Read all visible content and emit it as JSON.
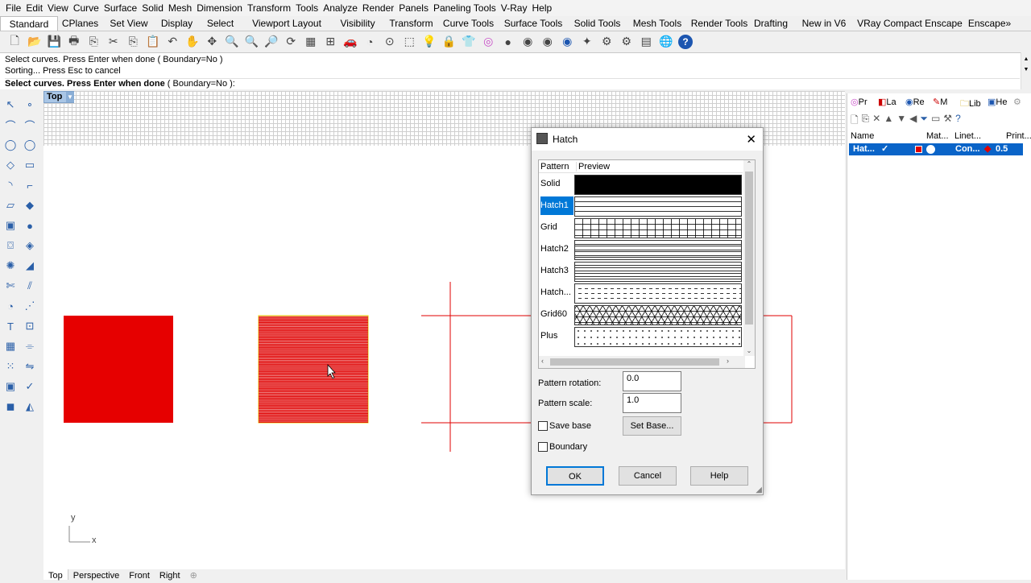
{
  "menu": [
    "File",
    "Edit",
    "View",
    "Curve",
    "Surface",
    "Solid",
    "Mesh",
    "Dimension",
    "Transform",
    "Tools",
    "Analyze",
    "Render",
    "Panels",
    "Paneling Tools",
    "V-Ray",
    "Help"
  ],
  "tabs": [
    "Standard",
    "CPlanes",
    "Set View",
    "Display",
    "Select",
    "Viewport Layout",
    "Visibility",
    "Transform",
    "Curve Tools",
    "Surface Tools",
    "Solid Tools",
    "Mesh Tools",
    "Render Tools",
    "Drafting",
    "New in V6",
    "VRay Compact",
    "Enscape",
    "Enscape»"
  ],
  "command": {
    "line1": "Select curves. Press Enter when done ( Boundary=No )",
    "line2": "Sorting... Press Esc to cancel",
    "prompt_bold": "Select curves. Press Enter when done",
    "prompt_tail": "( Boundary=No ):"
  },
  "viewport": {
    "name": "Top",
    "axis_y": "y",
    "axis_x": "x",
    "colors": {
      "red": "#e60000",
      "grid": "#cfcfcf"
    }
  },
  "bottom_tabs": [
    "Top",
    "Perspective",
    "Front",
    "Right"
  ],
  "panel": {
    "tabs": [
      "Pr",
      "La",
      "Re",
      "M",
      "Lib",
      "He"
    ],
    "columns": [
      "Name",
      "Mat...",
      "Linet...",
      "Print..."
    ],
    "row": {
      "name": "Hat...",
      "linetype": "Con...",
      "print": "0.5"
    }
  },
  "dialog": {
    "title": "Hatch",
    "col_pattern": "Pattern",
    "col_preview": "Preview",
    "patterns": [
      "Solid",
      "Hatch1",
      "Grid",
      "Hatch2",
      "Hatch3",
      "Hatch...",
      "Grid60",
      "Plus"
    ],
    "selected": "Hatch1",
    "rotation_label": "Pattern rotation:",
    "rotation_value": "0.0",
    "scale_label": "Pattern scale:",
    "scale_value": "1.0",
    "save_base": "Save base",
    "set_base": "Set Base...",
    "boundary": "Boundary",
    "ok": "OK",
    "cancel": "Cancel",
    "help": "Help"
  }
}
